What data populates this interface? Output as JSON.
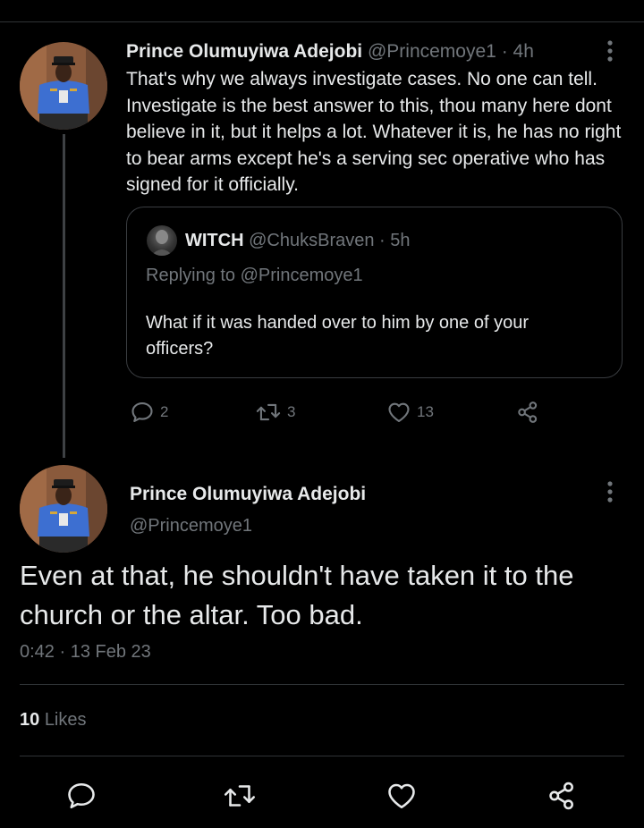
{
  "reply_tweet": {
    "author_name": "Prince Olumuyiwa Adejobi",
    "author_handle": "@Princemoye1",
    "separator": "·",
    "time_ago": "4h",
    "text": "That's why we always investigate cases. No one can tell. Investigate is the best answer to this, thou many here dont believe in it, but it helps a lot. Whatever it is, he has no right to bear arms except he's a serving sec operative who has signed for it officially.",
    "quoted": {
      "author_name": "WITCH",
      "author_handle": "@ChuksBraven",
      "separator": "·",
      "time_ago": "5h",
      "replying_to": "Replying to @Princemoye1",
      "text": "What if it was handed over to him by one of your officers?"
    },
    "actions": {
      "reply_count": "2",
      "retweet_count": "3",
      "like_count": "13"
    }
  },
  "main_tweet": {
    "author_name": "Prince Olumuyiwa Adejobi",
    "author_handle": "@Princemoye1",
    "text": "Even at that, he shouldn't have taken it to the church or the altar. Too bad.",
    "timestamp": "0:42 · 13 Feb 23",
    "likes_count": "10",
    "likes_label": "Likes"
  },
  "icons": {
    "reply": "comment-icon",
    "retweet": "retweet-icon",
    "like": "heart-icon",
    "share": "share-icon",
    "more": "more-vertical-icon"
  },
  "colors": {
    "background": "#000000",
    "text_primary": "#e7e9ea",
    "text_secondary": "#71767b",
    "border": "#2f3336",
    "uniform_blue": "#3d6fd1"
  }
}
